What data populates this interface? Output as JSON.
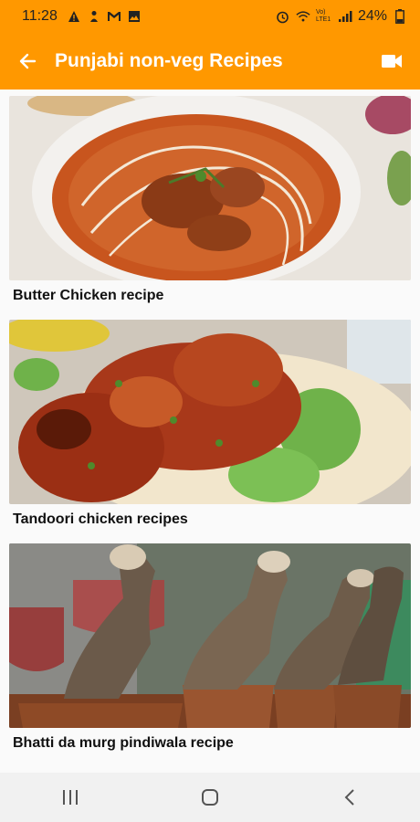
{
  "status_bar": {
    "time": "11:28",
    "battery": "24%",
    "network": "Vo) LTE1"
  },
  "app_bar": {
    "title": "Punjabi non-veg Recipes"
  },
  "recipes": [
    {
      "title": "Butter Chicken recipe"
    },
    {
      "title": "Tandoori chicken recipes"
    },
    {
      "title": "Bhatti da murg pindiwala recipe"
    }
  ],
  "colors": {
    "primary": "#ff9800",
    "title_text": "#ffffff",
    "nav_bar": "#f1f1f1"
  }
}
